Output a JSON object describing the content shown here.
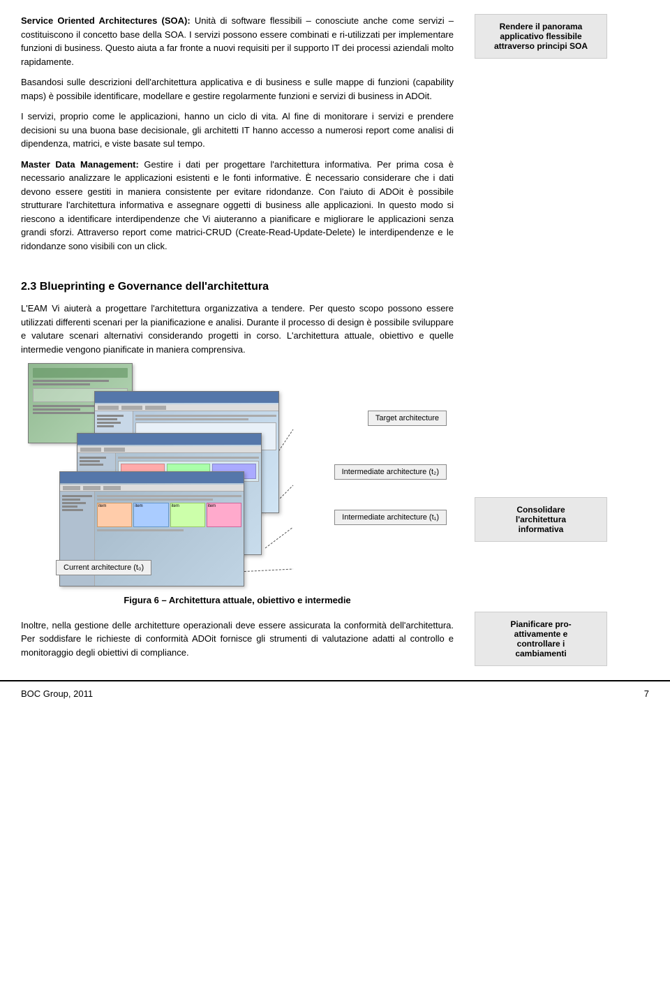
{
  "page": {
    "footer_company": "BOC Group, 2011",
    "footer_page": "7"
  },
  "sidebar": {
    "box1_line1": "Rendere il panorama",
    "box1_line2": "applicativo flessibile",
    "box1_line3": "attraverso principi SOA",
    "box2_line1": "Consolidare",
    "box2_line2": "l'architettura",
    "box2_line3": "informativa",
    "box3_line1": "Pianificare pro-",
    "box3_line2": "attivamente e",
    "box3_line3": "controllare i",
    "box3_line4": "cambiamenti"
  },
  "section1": {
    "heading_soa_bold": "Service Oriented Architectures (SOA):",
    "heading_soa_rest": " Unità di software flessibili – conosciute anche come servizi – costituiscono il concetto base della SOA. I servizi possono essere combinati e ri-utilizzati per implementare funzioni di business. Questo aiuta a far fronte a nuovi requisiti per il supporto IT dei processi aziendali molto rapidamente.",
    "para2": "Basandosi sulle descrizioni dell'architettura applicativa e di business e sulle mappe di funzioni (capability maps) è possibile identificare, modellare e gestire regolarmente funzioni e servizi di business in ADOit.",
    "para3": "I servizi, proprio come le applicazioni, hanno un ciclo di vita. Al fine di monitorare i servizi e prendere decisioni su una buona base decisionale, gli architetti IT hanno accesso a numerosi report come analisi di dipendenza, matrici, e viste basate sul tempo."
  },
  "section2": {
    "heading_bold": "Master Data Management:",
    "heading_rest": " Gestire i dati per progettare l'architettura informativa. Per prima cosa è necessario analizzare le applicazioni esistenti e le fonti informative. È necessario considerare che i dati devono essere gestiti in maniera consistente per evitare ridondanze. Con l'aiuto di ADOit è possibile strutturare l'architettura informativa e assegnare oggetti di business alle applicazioni. In questo modo si riescono a identificare interdipendenze che Vi aiuteranno a pianificare e migliorare le applicazioni senza grandi sforzi. Attraverso report come matrici-CRUD (Create-Read-Update-Delete) le interdipendenze e le ridondanze sono visibili con un click."
  },
  "section3": {
    "heading": "2.3 Blueprinting e Governance dell'architettura",
    "para1": "L'EAM Vi aiuterà a progettare l'architettura organizzativa a tendere. Per questo scopo possono essere utilizzati differenti scenari per la pianificazione e analisi. Durante il processo di design è possibile sviluppare e valutare scenari alternativi considerando progetti in corso. L'architettura attuale, obiettivo e quelle intermedie vengono pianificate in maniera comprensiva.",
    "label_target": "Target architecture",
    "label_inter2": "Intermediate architecture (t₂)",
    "label_inter1": "Intermediate architecture (t₁)",
    "label_current": "Current architecture (t₀)",
    "figure_caption": "Figura 6 – Architettura attuale, obiettivo e intermedie",
    "para2": "Inoltre, nella gestione delle architetture operazionali deve essere assicurata la conformità dell'architettura. Per soddisfare le richieste di conformità ADOit fornisce gli strumenti di valutazione adatti al controllo e monitoraggio degli obiettivi di compliance."
  }
}
